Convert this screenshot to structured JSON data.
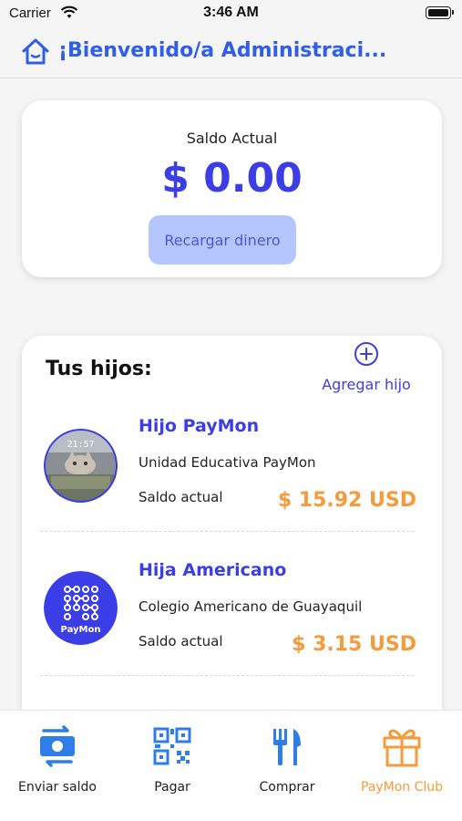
{
  "status_bar": {
    "carrier": "Carrier",
    "time": "3:46 AM"
  },
  "header": {
    "title": "¡Bienvenido/a Administraci..."
  },
  "balance": {
    "label": "Saldo Actual",
    "value": "$ 0.00",
    "recharge_label": "Recargar dinero"
  },
  "kids": {
    "title": "Tus hijos:",
    "add_label": "Agregar hijo",
    "items": [
      {
        "name": "Hijo PayMon",
        "school": "Unidad Educativa PayMon",
        "balance_label": "Saldo actual",
        "balance": "$ 15.92 USD",
        "avatar": "cat-photo"
      },
      {
        "name": "Hija Americano",
        "school": "Colegio Americano de Guayaquil",
        "balance_label": "Saldo actual",
        "balance": "$ 3.15 USD",
        "avatar": "paymon-logo",
        "avatar_text": "PayMon"
      }
    ]
  },
  "tabs": [
    {
      "label": "Enviar saldo",
      "icon": "transfer-money-icon"
    },
    {
      "label": "Pagar",
      "icon": "qr-code-icon"
    },
    {
      "label": "Comprar",
      "icon": "utensils-icon"
    },
    {
      "label": "PayMon Club",
      "icon": "gift-icon",
      "active": true
    }
  ],
  "colors": {
    "primary": "#3b3ee6",
    "header_blue": "#2f5ee8",
    "accent_orange": "#f59b3b",
    "button_bg": "#b5c6ff"
  }
}
